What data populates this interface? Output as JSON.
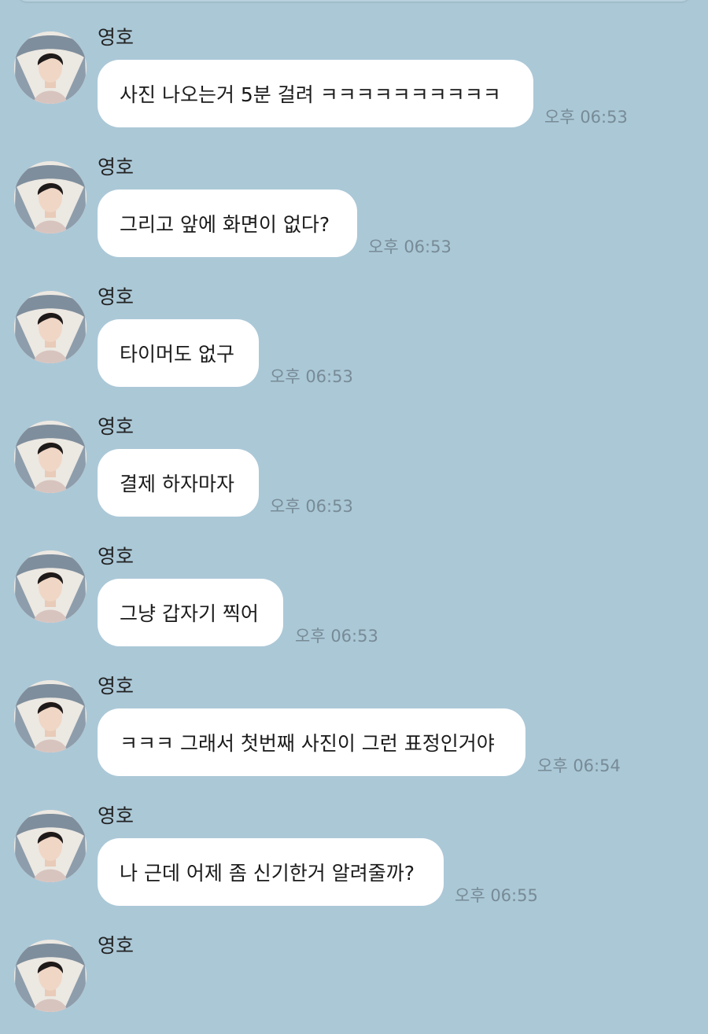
{
  "messages": [
    {
      "sender": "영호",
      "text": "사진 나오는거 5분 걸려 ㅋㅋㅋㅋㅋㅋㅋㅋㅋㅋ",
      "time": "오후 06:53"
    },
    {
      "sender": "영호",
      "text": "그리고 앞에 화면이 없다?",
      "time": "오후 06:53"
    },
    {
      "sender": "영호",
      "text": "타이머도 없구",
      "time": "오후 06:53"
    },
    {
      "sender": "영호",
      "text": "결제 하자마자",
      "time": "오후 06:53"
    },
    {
      "sender": "영호",
      "text": "그냥 갑자기 찍어",
      "time": "오후 06:53"
    },
    {
      "sender": "영호",
      "text": "ㅋㅋㅋ 그래서 첫번째 사진이 그런 표정인거야",
      "time": "오후 06:54"
    },
    {
      "sender": "영호",
      "text": "나 근데 어제 좀 신기한거 알려줄까?",
      "time": "오후 06:55"
    },
    {
      "sender": "영호",
      "text": "",
      "time": ""
    }
  ]
}
